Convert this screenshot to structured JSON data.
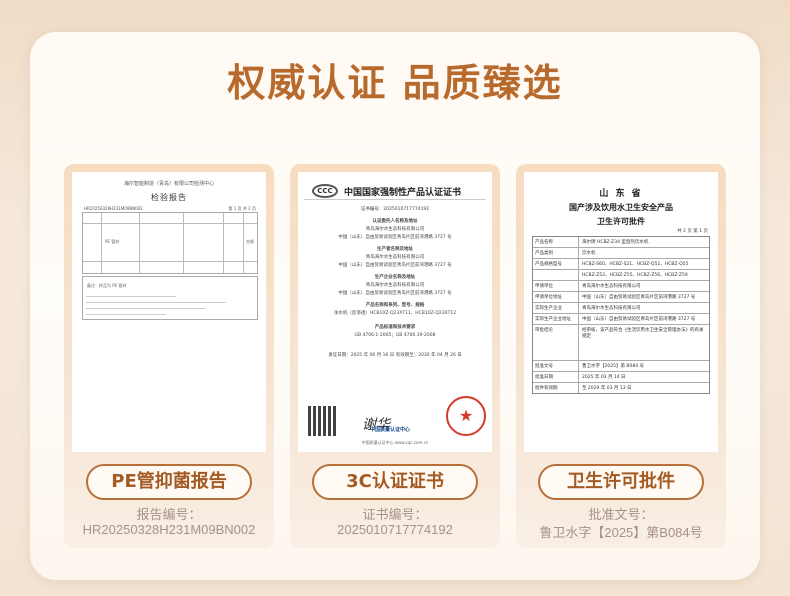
{
  "headline": "权威认证 品质臻选",
  "panels": [
    {
      "pill": "PE管抑菌报告",
      "caption_label": "报告编号：",
      "caption_value": "HR20250328H231M09BN002",
      "doc": {
        "org": "海尔智能制造（青岛）有限公司检测中心",
        "title": "检验报告",
        "report_no": "HR20250328H231M09BN002",
        "page": "第 1 页 共 2 页",
        "sample": "PE 管材",
        "result": "合格",
        "remark": "备注：样品为 PE 管材"
      }
    },
    {
      "pill": "3C认证证书",
      "caption_label": "证书编号：",
      "caption_value": "2025010717774192",
      "doc": {
        "title": "中国国家强制性产品认证证书",
        "cert_no": "证书编号：2025010717774192",
        "applicant_label": "认证委托人名称及地址",
        "applicant": "青岛海尔水生态科技有限公司",
        "address": "中国（山东）自由贸易试验区青岛片区前湾港路 3727 号",
        "maker_label": "生产者名称及地址",
        "factory_label": "生产企业名称及地址",
        "product_label": "产品名称和系列、型号、规格",
        "product": "净水机（反渗透）HCB10Z-Q23XT11、HCB10Z-Q23XT12",
        "std_label": "产品标准和技术要求",
        "std": "GB 4706.1-2005；GB 4706.19-2008",
        "issue": "发证日期：2025 年 06 月 16 日   有效期至：2030 年 04 月 26 日",
        "cqc": "中国质量认证中心",
        "foot": "中国质量认证中心 www.cqc.com.cn"
      }
    },
    {
      "pill": "卫生许可批件",
      "caption_label": "批准文号：",
      "caption_value": "鲁卫水字【2025】第B084号",
      "doc": {
        "province": "山 东 省",
        "title1": "国产涉及饮用水卫生安全产品",
        "title2": "卫生许可批件",
        "page": "共 2 页 第 1 页",
        "rows": [
          {
            "k": "产品名称",
            "v": "海尔牌 HCBZ-Z34 型直热饮水机"
          },
          {
            "k": "产品类别",
            "v": "饮水机"
          },
          {
            "k": "产品规格型号",
            "v": "HCBZ-S60、HCBZ-S21、HCBZ-Q51、HCBZ-Q55"
          },
          {
            "k": "",
            "v": "HCBZ-Z53、HCBZ-Z55、HCBZ-Z56、HCBZ-Z59"
          },
          {
            "k": "申请单位",
            "v": "青岛海尔水生态科技有限公司"
          },
          {
            "k": "申请单位地址",
            "v": "中国（山东）自由贸易试验区青岛片区前湾港路 3727 号"
          },
          {
            "k": "实际生产企业",
            "v": "青岛海尔水生态科技有限公司"
          },
          {
            "k": "实际生产企业地址",
            "v": "中国（山东）自由贸易试验区青岛片区前湾港路 3727 号"
          },
          {
            "k": "审批结论",
            "v": "经审核，该产品符合《生活饮用水卫生安全管理办法》的有关规定"
          },
          {
            "k": "批准文号",
            "v": "鲁卫水字【2025】第 B084 号"
          },
          {
            "k": "批准日期",
            "v": "2025 年 03 月 14 日"
          },
          {
            "k": "批件有效期",
            "v": "至 2029 年 03 月 13 日"
          }
        ]
      }
    }
  ]
}
